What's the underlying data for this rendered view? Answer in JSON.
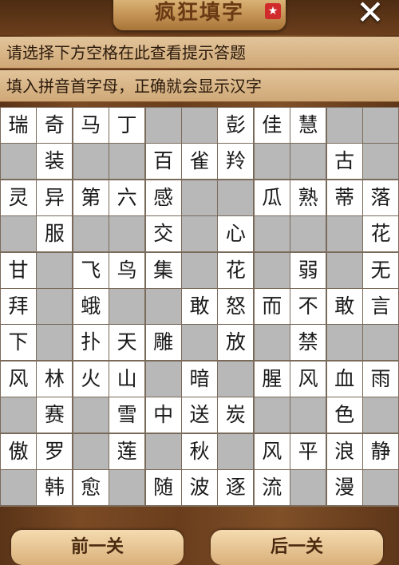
{
  "header": {
    "title": "疯狂填字",
    "close_icon": "close-icon"
  },
  "hints": {
    "line1": "请选择下方空格在此查看提示答题",
    "line2": "填入拼音首字母，正确就会显示汉字"
  },
  "grid": {
    "rows": [
      [
        "瑞",
        "奇",
        "马",
        "丁",
        "",
        "",
        "彭",
        "佳",
        "慧",
        "",
        ""
      ],
      [
        "",
        "装",
        "",
        "",
        "百",
        "雀",
        "羚",
        "",
        "",
        "古",
        ""
      ],
      [
        "灵",
        "异",
        "第",
        "六",
        "感",
        "",
        "",
        "瓜",
        "熟",
        "蒂",
        "落"
      ],
      [
        "",
        "服",
        "",
        "",
        "交",
        "",
        "心",
        "",
        "",
        "",
        "花"
      ],
      [
        "甘",
        "",
        "飞",
        "鸟",
        "集",
        "",
        "花",
        "",
        "弱",
        "",
        "无"
      ],
      [
        "拜",
        "",
        "蛾",
        "",
        "",
        "敢",
        "怒",
        "而",
        "不",
        "敢",
        "言"
      ],
      [
        "下",
        "",
        "扑",
        "天",
        "雕",
        "",
        "放",
        "",
        "禁",
        "",
        ""
      ],
      [
        "风",
        "林",
        "火",
        "山",
        "",
        "暗",
        "",
        "腥",
        "风",
        "血",
        "雨"
      ],
      [
        "",
        "赛",
        "",
        "雪",
        "中",
        "送",
        "炭",
        "",
        "",
        "色",
        ""
      ],
      [
        "傲",
        "罗",
        "",
        "莲",
        "",
        "秋",
        "",
        "风",
        "平",
        "浪",
        "静"
      ],
      [
        "",
        "韩",
        "愈",
        "",
        "随",
        "波",
        "逐",
        "流",
        "",
        "漫",
        ""
      ]
    ]
  },
  "nav": {
    "prev_label": "前一关",
    "next_label": "后一关"
  }
}
